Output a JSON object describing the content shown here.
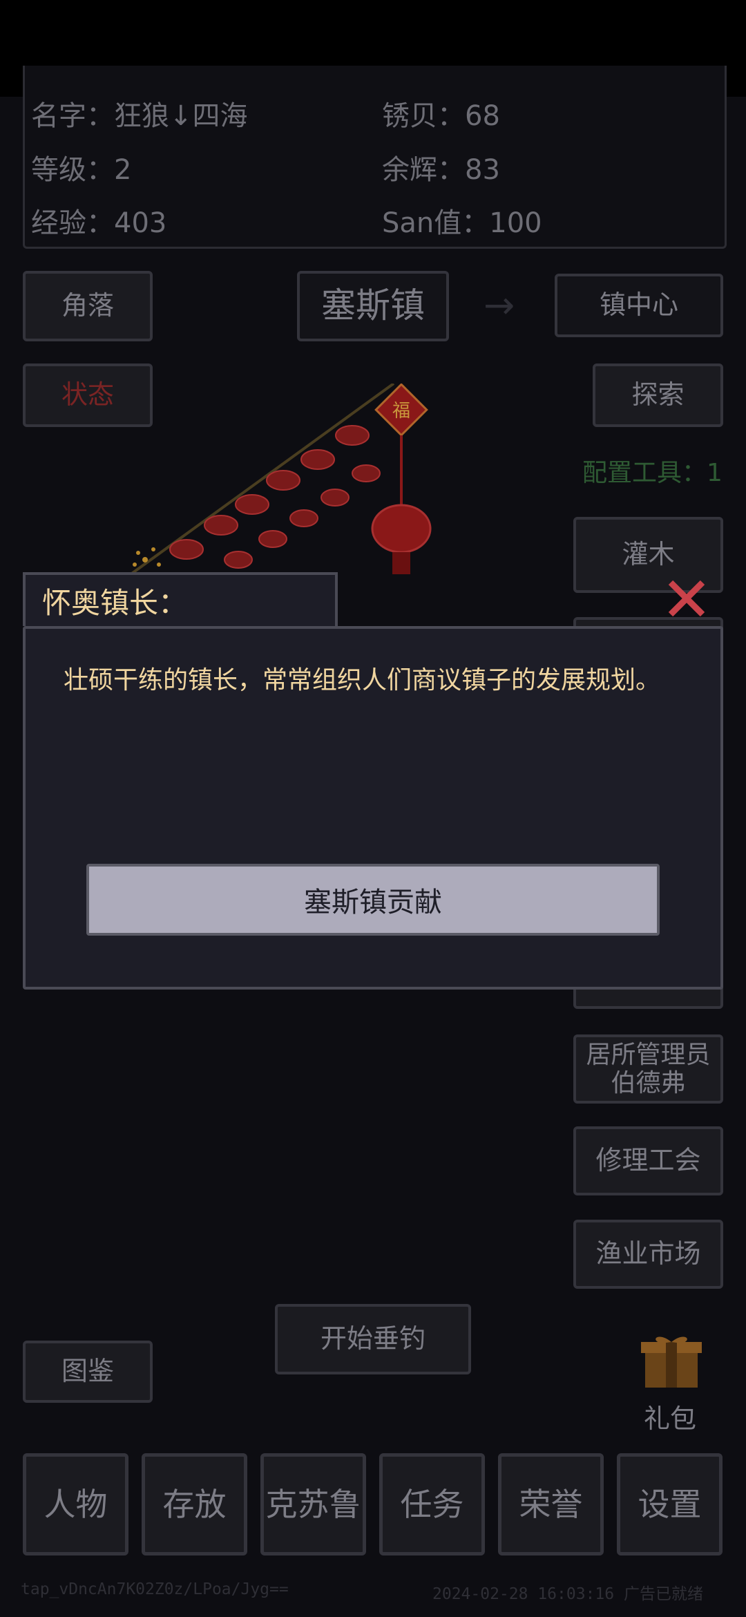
{
  "stats": {
    "name": "名字：狂狼↓四海",
    "shells": "锈贝：68",
    "level": "等级：2",
    "embers": "余辉：83",
    "exp": "经验：403",
    "san": "San值：100"
  },
  "location": {
    "corner": "角落",
    "town": "塞斯镇",
    "arrow": "→",
    "center": "镇中心"
  },
  "actions": {
    "status": "状态",
    "explore": "探索",
    "tool_config": "配置工具：1"
  },
  "npcs": [
    "灌木",
    "居所管理员\n伯德弗",
    "修理工会",
    "渔业市场"
  ],
  "dialog": {
    "title": "怀奥镇长：",
    "text": "壮硕干练的镇长，常常组织人们商议镇子的发展规划。",
    "button": "塞斯镇贡献"
  },
  "fishing": "开始垂钓",
  "codex": "图鉴",
  "gift": "礼包",
  "bottom_nav": [
    "人物",
    "存放",
    "克苏鲁",
    "任务",
    "荣誉",
    "设置"
  ],
  "footer": {
    "id": "tap_vDncAn7K02Z0z/LPoa/Jyg==",
    "status": "2024-02-28 16:03:16 广告已就绪"
  },
  "colors": {
    "dialog_text": "#f1d6a0",
    "status_red": "#7a2424",
    "close_red": "#c9424a",
    "tool_green": "#2e5a33"
  }
}
